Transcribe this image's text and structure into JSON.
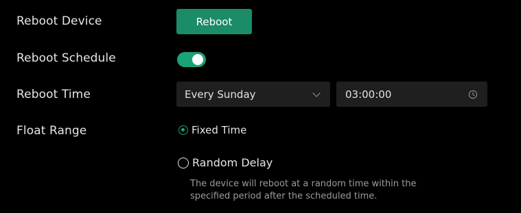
{
  "settings": {
    "reboot_device": {
      "label": "Reboot Device",
      "button_label": "Reboot"
    },
    "reboot_schedule": {
      "label": "Reboot Schedule",
      "enabled": true
    },
    "reboot_time": {
      "label": "Reboot Time",
      "day_selected": "Every Sunday",
      "time_value": "03:00:00",
      "dropdown_icon": "chevron-down-icon",
      "time_icon": "clock-icon"
    },
    "float_range": {
      "label": "Float Range",
      "options": [
        {
          "label": "Fixed Time",
          "selected": true
        },
        {
          "label": "Random Delay",
          "selected": false
        }
      ],
      "helper_text_line1": "The device will reboot at a random time within the",
      "helper_text_line2": "specified period after the scheduled time."
    }
  },
  "colors": {
    "background": "#000000",
    "accent": "#1aa379",
    "button": "#1a8c67",
    "field_background": "#1f1f1f",
    "helper_text": "#9c9c9c"
  }
}
